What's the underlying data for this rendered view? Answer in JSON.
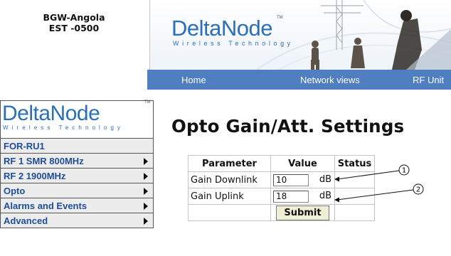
{
  "site": {
    "name": "BGW-Angola",
    "timezone": "EST -0500"
  },
  "brand": {
    "wordmark": "DeltaNode",
    "tagline": "Wireless Technology",
    "trademark": "TM",
    "color": "#2a6fb8"
  },
  "nav": {
    "items": [
      "Home",
      "Network views",
      "RF Unit"
    ],
    "bar_color": "#4f7fc0"
  },
  "sidebar": {
    "items": [
      {
        "label": "FOR-RU1",
        "has_submenu": false
      },
      {
        "label": "RF 1 SMR 800MHz",
        "has_submenu": true
      },
      {
        "label": "RF 2 1900MHz",
        "has_submenu": true
      },
      {
        "label": "Opto",
        "has_submenu": true
      },
      {
        "label": "Alarms and Events",
        "has_submenu": true
      },
      {
        "label": "Advanced",
        "has_submenu": true
      }
    ],
    "label_color": "#1f4d9a"
  },
  "page": {
    "title": "Opto Gain/Att. Settings"
  },
  "table": {
    "headers": {
      "parameter": "Parameter",
      "value": "Value",
      "status": "Status"
    },
    "rows": [
      {
        "parameter": "Gain Downlink",
        "value": "10",
        "unit": "dB",
        "status": ""
      },
      {
        "parameter": "Gain Uplink",
        "value": "18",
        "unit": "dB",
        "status": ""
      }
    ],
    "submit_label": "Submit"
  },
  "callouts": [
    "1",
    "2"
  ]
}
